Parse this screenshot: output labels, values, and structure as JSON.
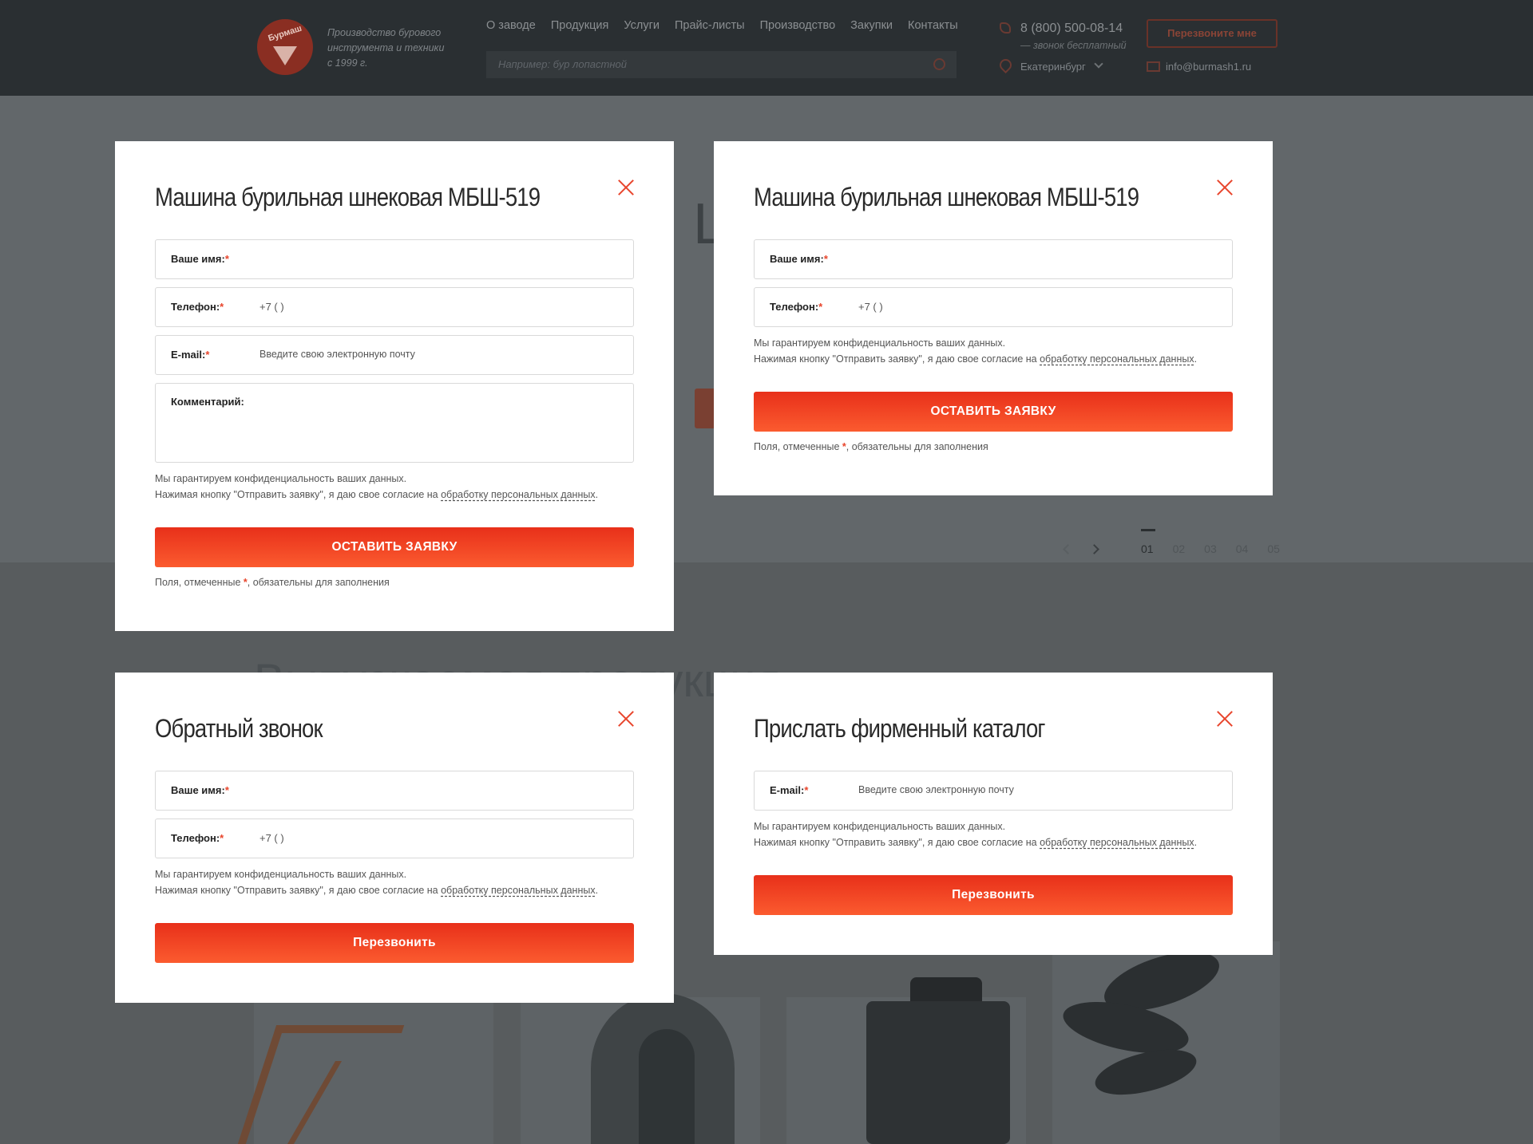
{
  "header": {
    "logo_text": "Бурмаш",
    "tagline": "Производство бурового инструмента и техники с 1999 г.",
    "nav": [
      "О заводе",
      "Продукция",
      "Услуги",
      "Прайс-листы",
      "Производство",
      "Закупки",
      "Контакты"
    ],
    "search_placeholder": "Например: бур лопастной",
    "phone": "8 (800) 500-08-14",
    "phone_note": "— звонок бесплатный",
    "callback_button": "Перезвоните мне",
    "city": "Екатеринбург",
    "email": "info@burmash1.ru"
  },
  "background": {
    "hero_letter": "Ш",
    "products_title": "Выпускаемая продукция",
    "slider_pages": [
      "01",
      "02",
      "03",
      "04",
      "05"
    ],
    "slider_active": "01"
  },
  "common": {
    "required_mark": "*",
    "phone_prefix": "+7  (         )",
    "email_placeholder": "Введите свою электронную почту",
    "privacy_line1": "Мы гарантируем конфиденциальность ваших данных.",
    "privacy_line2_prefix": "Нажимая кнопку \"Отправить заявку\", я даю свое согласие на ",
    "privacy_link": "обработку персональных данных",
    "privacy_line2_suffix": ".",
    "required_note_prefix": "Поля, отмеченные ",
    "required_note_suffix": ", обязательны для заполнения"
  },
  "modal_order_full": {
    "title": "Машина бурильная шнековая МБШ-519",
    "name_label": "Ваше имя:",
    "phone_label": "Телефон:",
    "email_label": "E-mail:",
    "comment_label": "Комментарий:",
    "submit": "ОСТАВИТЬ ЗАЯВКУ"
  },
  "modal_order_short": {
    "title": "Машина бурильная шнековая МБШ-519",
    "name_label": "Ваше имя:",
    "phone_label": "Телефон:",
    "submit": "ОСТАВИТЬ ЗАЯВКУ"
  },
  "modal_callback": {
    "title": "Обратный звонок",
    "name_label": "Ваше имя:",
    "phone_label": "Телефон:",
    "submit": "Перезвонить"
  },
  "modal_catalog": {
    "title": "Прислать фирменный каталог",
    "email_label": "E-mail:",
    "submit": "Перезвонить"
  },
  "colors": {
    "accent": "#e8452c",
    "button_top": "#e8301a",
    "button_bottom": "#fb5b2f",
    "overlay": "#585c5e"
  }
}
